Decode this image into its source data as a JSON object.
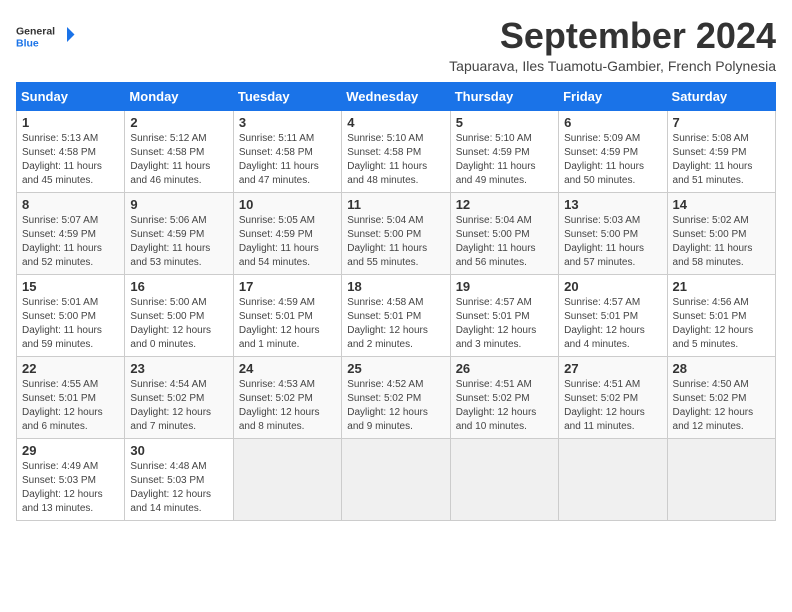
{
  "header": {
    "logo_line1": "General",
    "logo_line2": "Blue",
    "month_title": "September 2024",
    "subtitle": "Tapuarava, Iles Tuamotu-Gambier, French Polynesia"
  },
  "weekdays": [
    "Sunday",
    "Monday",
    "Tuesday",
    "Wednesday",
    "Thursday",
    "Friday",
    "Saturday"
  ],
  "rows": [
    [
      {
        "day": "1",
        "info": "Sunrise: 5:13 AM\nSunset: 4:58 PM\nDaylight: 11 hours\nand 45 minutes."
      },
      {
        "day": "2",
        "info": "Sunrise: 5:12 AM\nSunset: 4:58 PM\nDaylight: 11 hours\nand 46 minutes."
      },
      {
        "day": "3",
        "info": "Sunrise: 5:11 AM\nSunset: 4:58 PM\nDaylight: 11 hours\nand 47 minutes."
      },
      {
        "day": "4",
        "info": "Sunrise: 5:10 AM\nSunset: 4:58 PM\nDaylight: 11 hours\nand 48 minutes."
      },
      {
        "day": "5",
        "info": "Sunrise: 5:10 AM\nSunset: 4:59 PM\nDaylight: 11 hours\nand 49 minutes."
      },
      {
        "day": "6",
        "info": "Sunrise: 5:09 AM\nSunset: 4:59 PM\nDaylight: 11 hours\nand 50 minutes."
      },
      {
        "day": "7",
        "info": "Sunrise: 5:08 AM\nSunset: 4:59 PM\nDaylight: 11 hours\nand 51 minutes."
      }
    ],
    [
      {
        "day": "8",
        "info": "Sunrise: 5:07 AM\nSunset: 4:59 PM\nDaylight: 11 hours\nand 52 minutes."
      },
      {
        "day": "9",
        "info": "Sunrise: 5:06 AM\nSunset: 4:59 PM\nDaylight: 11 hours\nand 53 minutes."
      },
      {
        "day": "10",
        "info": "Sunrise: 5:05 AM\nSunset: 4:59 PM\nDaylight: 11 hours\nand 54 minutes."
      },
      {
        "day": "11",
        "info": "Sunrise: 5:04 AM\nSunset: 5:00 PM\nDaylight: 11 hours\nand 55 minutes."
      },
      {
        "day": "12",
        "info": "Sunrise: 5:04 AM\nSunset: 5:00 PM\nDaylight: 11 hours\nand 56 minutes."
      },
      {
        "day": "13",
        "info": "Sunrise: 5:03 AM\nSunset: 5:00 PM\nDaylight: 11 hours\nand 57 minutes."
      },
      {
        "day": "14",
        "info": "Sunrise: 5:02 AM\nSunset: 5:00 PM\nDaylight: 11 hours\nand 58 minutes."
      }
    ],
    [
      {
        "day": "15",
        "info": "Sunrise: 5:01 AM\nSunset: 5:00 PM\nDaylight: 11 hours\nand 59 minutes."
      },
      {
        "day": "16",
        "info": "Sunrise: 5:00 AM\nSunset: 5:00 PM\nDaylight: 12 hours\nand 0 minutes."
      },
      {
        "day": "17",
        "info": "Sunrise: 4:59 AM\nSunset: 5:01 PM\nDaylight: 12 hours\nand 1 minute."
      },
      {
        "day": "18",
        "info": "Sunrise: 4:58 AM\nSunset: 5:01 PM\nDaylight: 12 hours\nand 2 minutes."
      },
      {
        "day": "19",
        "info": "Sunrise: 4:57 AM\nSunset: 5:01 PM\nDaylight: 12 hours\nand 3 minutes."
      },
      {
        "day": "20",
        "info": "Sunrise: 4:57 AM\nSunset: 5:01 PM\nDaylight: 12 hours\nand 4 minutes."
      },
      {
        "day": "21",
        "info": "Sunrise: 4:56 AM\nSunset: 5:01 PM\nDaylight: 12 hours\nand 5 minutes."
      }
    ],
    [
      {
        "day": "22",
        "info": "Sunrise: 4:55 AM\nSunset: 5:01 PM\nDaylight: 12 hours\nand 6 minutes."
      },
      {
        "day": "23",
        "info": "Sunrise: 4:54 AM\nSunset: 5:02 PM\nDaylight: 12 hours\nand 7 minutes."
      },
      {
        "day": "24",
        "info": "Sunrise: 4:53 AM\nSunset: 5:02 PM\nDaylight: 12 hours\nand 8 minutes."
      },
      {
        "day": "25",
        "info": "Sunrise: 4:52 AM\nSunset: 5:02 PM\nDaylight: 12 hours\nand 9 minutes."
      },
      {
        "day": "26",
        "info": "Sunrise: 4:51 AM\nSunset: 5:02 PM\nDaylight: 12 hours\nand 10 minutes."
      },
      {
        "day": "27",
        "info": "Sunrise: 4:51 AM\nSunset: 5:02 PM\nDaylight: 12 hours\nand 11 minutes."
      },
      {
        "day": "28",
        "info": "Sunrise: 4:50 AM\nSunset: 5:02 PM\nDaylight: 12 hours\nand 12 minutes."
      }
    ],
    [
      {
        "day": "29",
        "info": "Sunrise: 4:49 AM\nSunset: 5:03 PM\nDaylight: 12 hours\nand 13 minutes."
      },
      {
        "day": "30",
        "info": "Sunrise: 4:48 AM\nSunset: 5:03 PM\nDaylight: 12 hours\nand 14 minutes."
      },
      {
        "day": "",
        "info": ""
      },
      {
        "day": "",
        "info": ""
      },
      {
        "day": "",
        "info": ""
      },
      {
        "day": "",
        "info": ""
      },
      {
        "day": "",
        "info": ""
      }
    ]
  ]
}
